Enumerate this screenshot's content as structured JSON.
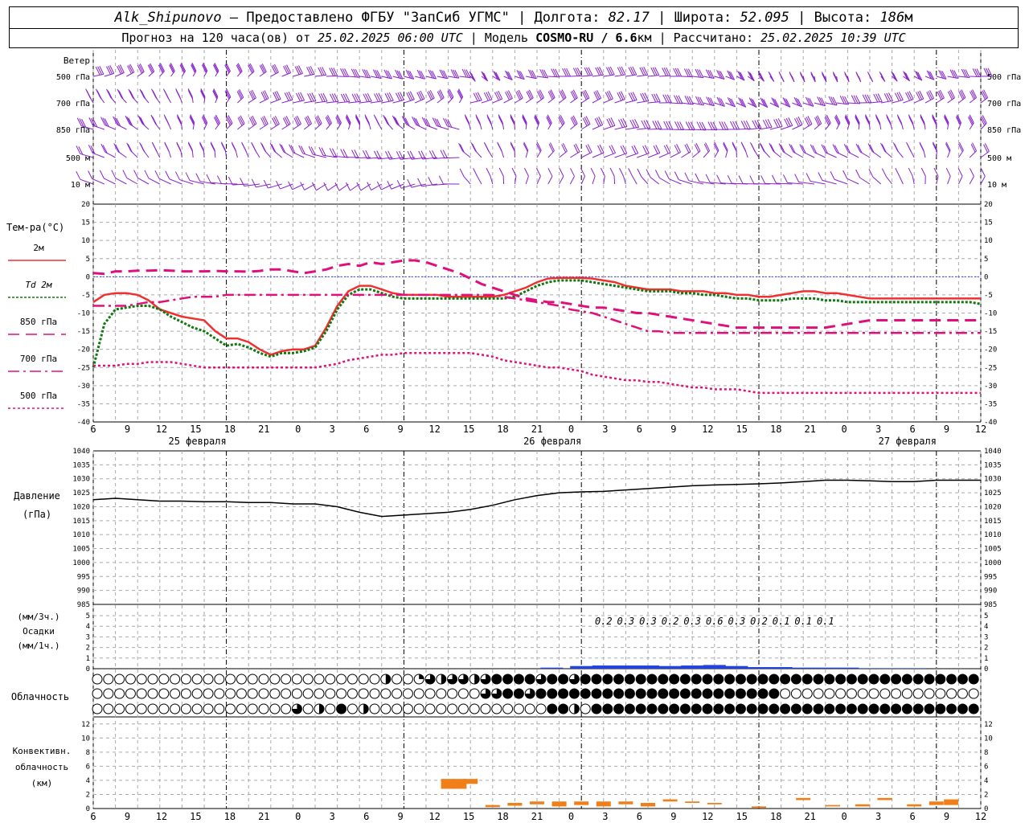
{
  "header": {
    "station": "Alk_Shipunovo",
    "provider": " – Предоставлено ФГБУ \"ЗапСиб УГМС\" | Долгота: ",
    "lon": "82.17",
    "lat_label": " | Широта: ",
    "lat": "52.095",
    "alt_label": " | Высота: ",
    "alt": "186",
    "alt_unit": "м",
    "forecast_label": "Прогноз на 120 часа(ов) от ",
    "start_time": "25.02.2025 06:00 UTC",
    "model_label": "  | Модель ",
    "model": "COSMO-RU / 6.6",
    "model_unit": "км",
    "calc_label": " | Рассчитано: ",
    "calc_time": "25.02.2025 10:39 UTC"
  },
  "colors": {
    "wind": "#8822cc",
    "t2m": "#f03030",
    "td2m": "#107810",
    "t850": "#e0107a",
    "t700": "#e0107a",
    "t500": "#e0107a",
    "zero_line": "#3344dd",
    "pressure": "#000000",
    "precip": "#2244dd",
    "conv": "#f07f1a",
    "grid": "#aaaaaa"
  },
  "time_axis": {
    "ticks": [
      "6",
      "9",
      "12",
      "15",
      "18",
      "21",
      "0",
      "3",
      "6",
      "9",
      "12",
      "15",
      "18",
      "21",
      "0",
      "3",
      "6",
      "9",
      "12",
      "15",
      "18",
      "21",
      "0",
      "3",
      "6",
      "9",
      "12"
    ],
    "dates": [
      "25 февраля",
      "26 февраля",
      "27 февраля"
    ]
  },
  "wind_panel": {
    "title": "Ветер",
    "levels": [
      "500 гПа",
      "700 гПа",
      "850 гПа",
      "500 м",
      "10  м"
    ]
  },
  "temp_panel": {
    "title": "Тем-ра(°C)",
    "legend": [
      {
        "label": "2м",
        "style": "solid"
      },
      {
        "label": "Td 2м",
        "style": "dotted-thick"
      },
      {
        "label": "850 гПа",
        "style": "dash"
      },
      {
        "label": "700 гПа",
        "style": "dashdot"
      },
      {
        "label": "500 гПа",
        "style": "dot"
      }
    ]
  },
  "pressure_panel": {
    "title_1": "Давление",
    "title_2": "(гПа)"
  },
  "precip_panel": {
    "title_1": "(мм/3ч.)",
    "title_2": "Осадки",
    "title_3": "(мм/1ч.)"
  },
  "cloud_panel": {
    "title": "Облачность"
  },
  "conv_panel": {
    "title_1": "Конвективн.",
    "title_2": "облачность",
    "title_3": "(км)"
  },
  "chart_data": [
    {
      "type": "line",
      "name": "temperature",
      "x_hours": [
        0,
        1.5,
        3,
        4.5,
        6,
        7.5,
        9,
        10.5,
        12,
        13.5,
        15,
        16.5,
        18,
        19.5,
        21,
        22.5,
        24,
        25.5,
        27,
        28.5,
        30,
        31.5,
        33,
        34.5,
        36,
        37.5,
        39,
        40.5,
        42,
        43.5,
        45,
        46.5,
        48,
        49.5,
        51,
        52.5,
        54,
        55.5,
        57,
        58.5,
        60,
        61.5,
        63,
        64.5,
        66,
        67.5,
        69,
        70.5,
        72,
        73.5,
        75,
        76.5,
        78,
        79.5,
        81,
        82.5,
        84,
        85.5,
        87,
        88.5,
        90,
        91.5,
        93,
        94.5,
        96,
        97.5,
        99,
        100.5,
        102,
        103.5,
        105,
        106.5,
        108,
        109.5,
        111,
        112.5,
        114,
        115.5,
        117,
        118.5,
        120
      ],
      "ylim": [
        -40,
        20
      ],
      "yticks": [
        -40,
        -35,
        -30,
        -25,
        -20,
        -15,
        -10,
        -5,
        0,
        5,
        10,
        15,
        20
      ],
      "series": [
        {
          "name": "2м",
          "values": [
            -7,
            -5,
            -4.5,
            -4.5,
            -5,
            -6.5,
            -9,
            -10,
            -11,
            -11.5,
            -12,
            -15,
            -17,
            -17,
            -18,
            -20,
            -21.5,
            -20.5,
            -20,
            -20,
            -19,
            -14,
            -8,
            -4,
            -2.5,
            -2.5,
            -3.5,
            -4.5,
            -5,
            -5,
            -5,
            -5,
            -5.5,
            -5.5,
            -5.5,
            -5.5,
            -5.5,
            -5,
            -4,
            -3,
            -1.5,
            -0.5,
            -0.3,
            -0.3,
            -0.3,
            -0.5,
            -1,
            -1.5,
            -2.5,
            -3,
            -3.5,
            -3.5,
            -3.5,
            -4,
            -4,
            -4,
            -4.5,
            -4.5,
            -5,
            -5,
            -5.5,
            -5.5,
            -5,
            -4.5,
            -4,
            -4,
            -4.5,
            -4.5,
            -5,
            -5.5,
            -6,
            -6,
            -6,
            -6,
            -6,
            -6,
            -6,
            -6,
            -6,
            -6,
            -6
          ]
        },
        {
          "name": "Td 2м",
          "values": [
            -25,
            -13,
            -9,
            -8.5,
            -8,
            -8,
            -9,
            -11,
            -12.5,
            -14,
            -15,
            -17,
            -19,
            -18.5,
            -19.5,
            -21,
            -22,
            -21,
            -21,
            -20.5,
            -19.5,
            -15,
            -9,
            -5,
            -3.5,
            -3.5,
            -4.5,
            -5.5,
            -6,
            -6,
            -6,
            -6,
            -6,
            -6,
            -6,
            -6,
            -6,
            -6,
            -5.5,
            -4,
            -2.5,
            -1.5,
            -1,
            -1,
            -1,
            -1.5,
            -2,
            -2.5,
            -3,
            -3.5,
            -4,
            -4,
            -4,
            -4.5,
            -4.5,
            -5,
            -5,
            -5.5,
            -6,
            -6,
            -6.5,
            -6.5,
            -6.5,
            -6,
            -6,
            -6,
            -6.5,
            -6.5,
            -7,
            -7,
            -7,
            -7,
            -7,
            -7,
            -7,
            -7,
            -7,
            -7,
            -7,
            -7,
            -7.5
          ]
        },
        {
          "name": "850 гПа",
          "values": [
            1,
            0.8,
            1.5,
            1.5,
            1.7,
            1.7,
            1.8,
            1.7,
            1.5,
            1.5,
            1.5,
            1.6,
            1.5,
            1.5,
            1.4,
            1.6,
            2,
            2,
            1.5,
            1,
            1.5,
            2,
            3,
            3.5,
            3,
            4,
            3.5,
            4,
            4.5,
            4.5,
            4,
            3,
            2,
            1,
            -0.5,
            -2,
            -3,
            -4,
            -5,
            -6,
            -6.5,
            -7,
            -7,
            -7.5,
            -8,
            -8.5,
            -8.5,
            -9,
            -9.5,
            -10,
            -10,
            -10.5,
            -11,
            -11.5,
            -12,
            -12.5,
            -13,
            -13.5,
            -14,
            -14,
            -14,
            -14,
            -14,
            -14,
            -14,
            -14,
            -14,
            -13.5,
            -13,
            -12.5,
            -12,
            -12,
            -12,
            -12,
            -12,
            -12,
            -12,
            -12,
            -12,
            -12,
            -12
          ]
        },
        {
          "name": "700 гПа",
          "values": [
            -8,
            -8,
            -8,
            -8,
            -7.5,
            -7,
            -7,
            -6.5,
            -6,
            -5.5,
            -5.5,
            -5.5,
            -5,
            -5,
            -5,
            -5,
            -5,
            -5,
            -5,
            -5,
            -5,
            -5,
            -5,
            -5,
            -5,
            -5,
            -5,
            -5,
            -5,
            -5,
            -5,
            -5,
            -5,
            -5,
            -5,
            -5,
            -5,
            -5.5,
            -6,
            -6.5,
            -7,
            -7.5,
            -8,
            -9,
            -9.5,
            -10,
            -11,
            -12,
            -13,
            -14,
            -15,
            -15,
            -15.5,
            -15.5,
            -15.5,
            -15.5,
            -15.5,
            -15.5,
            -15.5,
            -15.5,
            -15.5,
            -15.5,
            -15.5,
            -15.5,
            -15.5,
            -15.5,
            -15.5,
            -15.5,
            -15.5,
            -15.5,
            -15.5,
            -15.5,
            -15.5,
            -15.5,
            -15.5,
            -15.5,
            -15.5,
            -15.5,
            -15.5,
            -15.5,
            -15.5
          ]
        },
        {
          "name": "500 гПа",
          "values": [
            -24.5,
            -24.5,
            -24.5,
            -24,
            -24,
            -23.5,
            -23.5,
            -23.5,
            -24,
            -24.5,
            -25,
            -25,
            -25,
            -25,
            -25,
            -25,
            -25,
            -25,
            -25,
            -25,
            -25,
            -24.5,
            -24,
            -23,
            -22.5,
            -22,
            -21.5,
            -21.5,
            -21,
            -21,
            -21,
            -21,
            -21,
            -21,
            -21,
            -21.5,
            -22,
            -23,
            -23.5,
            -24,
            -24.5,
            -25,
            -25,
            -25.5,
            -26,
            -27,
            -27.5,
            -28,
            -28.5,
            -28.5,
            -29,
            -29,
            -29.5,
            -30,
            -30.5,
            -30.5,
            -31,
            -31,
            -31,
            -31.5,
            -32,
            -32,
            -32,
            -32,
            -32,
            -32,
            -32,
            -32,
            -32,
            -32,
            -32,
            -32,
            -32,
            -32,
            -32,
            -32,
            -32,
            -32,
            -32,
            -32,
            -32
          ]
        }
      ]
    },
    {
      "type": "line",
      "name": "pressure",
      "x_hours": [
        0,
        3,
        6,
        9,
        12,
        15,
        18,
        21,
        24,
        27,
        30,
        33,
        36,
        39,
        42,
        45,
        48,
        51,
        54,
        57,
        60,
        63,
        66,
        69,
        72,
        75,
        78,
        81,
        84,
        87,
        90,
        93,
        96,
        99,
        102,
        105,
        108,
        111,
        114,
        117,
        120
      ],
      "ylim": [
        985,
        1040
      ],
      "yticks": [
        985,
        990,
        995,
        1000,
        1005,
        1010,
        1015,
        1020,
        1025,
        1030,
        1035,
        1040
      ],
      "values": [
        1022.5,
        1023,
        1022.5,
        1022,
        1022,
        1021.8,
        1021.8,
        1021.5,
        1021.5,
        1021,
        1021,
        1020,
        1018,
        1016.5,
        1017,
        1017.5,
        1018,
        1019,
        1020.5,
        1022.5,
        1024,
        1025,
        1025.3,
        1025.5,
        1026,
        1026.5,
        1027,
        1027.5,
        1027.8,
        1028,
        1028.2,
        1028.5,
        1029,
        1029.5,
        1029.5,
        1029.3,
        1029,
        1029,
        1029.5,
        1029.5,
        1029.5
      ]
    },
    {
      "type": "bar",
      "name": "precipitation",
      "ylim": [
        0,
        5
      ],
      "yticks": [
        0,
        1,
        2,
        3,
        4,
        5
      ],
      "labels_x_hours": [
        69,
        72,
        75,
        78,
        81,
        84,
        87,
        90,
        93,
        96,
        99
      ],
      "labels": [
        "0.2",
        "0.3",
        "0.3",
        "0.2",
        "0.3",
        "0.6",
        "0.3",
        "0.2",
        "0.1",
        "0.1",
        "0.1"
      ],
      "hourly_x": [
        62,
        66,
        69,
        72,
        75,
        78,
        81,
        84,
        87,
        90,
        93,
        96,
        99,
        102,
        105,
        108,
        111
      ],
      "hourly_values": [
        0.1,
        0.25,
        0.3,
        0.3,
        0.3,
        0.25,
        0.3,
        0.35,
        0.25,
        0.15,
        0.15,
        0.1,
        0.1,
        0.1,
        0.05,
        0.05,
        0.05
      ]
    },
    {
      "type": "table",
      "name": "cloudiness",
      "note": "three rows of cloud cover symbols, 81 per row (1.5h step); value = tenths of octants filled 0..4",
      "rows": [
        [
          0,
          0,
          0,
          0,
          0,
          0,
          0,
          0,
          0,
          0,
          0,
          0,
          0,
          0,
          0,
          0,
          0,
          0,
          0,
          0,
          0,
          0,
          0,
          0,
          0,
          0,
          2,
          0,
          0,
          1,
          3,
          2,
          3,
          3,
          2,
          3,
          4,
          4,
          4,
          4,
          3,
          4,
          4,
          3,
          4,
          4,
          4,
          4,
          4,
          4,
          4,
          4,
          4,
          4,
          4,
          4,
          4,
          4,
          4,
          4,
          4,
          4,
          4,
          4,
          4,
          4,
          4,
          4,
          4,
          4,
          4,
          4,
          4,
          4,
          4,
          4,
          4,
          4,
          4,
          4,
          4
        ],
        [
          0,
          0,
          0,
          0,
          0,
          0,
          0,
          0,
          0,
          0,
          0,
          0,
          0,
          0,
          0,
          0,
          0,
          0,
          0,
          0,
          0,
          0,
          0,
          0,
          0,
          0,
          0,
          0,
          0,
          0,
          0,
          0,
          0,
          0,
          0,
          3,
          3,
          4,
          4,
          3,
          4,
          4,
          4,
          4,
          4,
          4,
          4,
          4,
          4,
          4,
          4,
          4,
          4,
          4,
          4,
          4,
          4,
          4,
          4,
          4,
          4,
          4,
          0,
          0,
          0,
          0,
          0,
          0,
          0,
          0,
          0,
          0,
          0,
          0,
          0,
          0,
          0,
          0,
          0,
          0,
          0
        ],
        [
          0,
          0,
          0,
          0,
          0,
          0,
          0,
          0,
          0,
          0,
          0,
          0,
          0,
          0,
          0,
          0,
          0,
          0,
          3,
          0,
          2,
          0,
          4,
          0,
          2,
          0,
          0,
          0,
          0,
          0,
          0,
          0,
          0,
          0,
          0,
          0,
          0,
          0,
          0,
          0,
          0,
          4,
          4,
          2,
          0,
          4,
          4,
          4,
          4,
          4,
          4,
          4,
          4,
          4,
          4,
          4,
          4,
          4,
          4,
          4,
          4,
          4,
          4,
          4,
          4,
          4,
          4,
          4,
          4,
          4,
          4,
          4,
          4,
          4,
          4,
          4,
          4,
          4,
          4,
          4,
          4
        ]
      ]
    },
    {
      "type": "bar",
      "name": "convective_cloud",
      "ylim": [
        0,
        13
      ],
      "yticks": [
        0,
        2,
        4,
        6,
        8,
        10,
        12
      ],
      "bars": [
        {
          "x": 48,
          "bottom": 2.8,
          "top": 4.2
        },
        {
          "x": 49.5,
          "bottom": 2.8,
          "top": 4.2
        },
        {
          "x": 51,
          "bottom": 3.5,
          "top": 4.2
        },
        {
          "x": 54,
          "bottom": 0.2,
          "top": 0.5
        },
        {
          "x": 57,
          "bottom": 0.4,
          "top": 0.8
        },
        {
          "x": 60,
          "bottom": 0.6,
          "top": 1.0
        },
        {
          "x": 63,
          "bottom": 0.3,
          "top": 1.0
        },
        {
          "x": 66,
          "bottom": 0.5,
          "top": 1.0
        },
        {
          "x": 69,
          "bottom": 0.3,
          "top": 1.0
        },
        {
          "x": 72,
          "bottom": 0.6,
          "top": 1.0
        },
        {
          "x": 75,
          "bottom": 0.3,
          "top": 0.8
        },
        {
          "x": 78,
          "bottom": 1.0,
          "top": 1.3
        },
        {
          "x": 81,
          "bottom": 0.8,
          "top": 1.0
        },
        {
          "x": 84,
          "bottom": 0.6,
          "top": 0.8
        },
        {
          "x": 90,
          "bottom": 0.1,
          "top": 0.3
        },
        {
          "x": 96,
          "bottom": 1.2,
          "top": 1.5
        },
        {
          "x": 100,
          "bottom": 0.3,
          "top": 0.5
        },
        {
          "x": 104,
          "bottom": 0.3,
          "top": 0.6
        },
        {
          "x": 107,
          "bottom": 1.2,
          "top": 1.5
        },
        {
          "x": 111,
          "bottom": 0.3,
          "top": 0.6
        },
        {
          "x": 114,
          "bottom": 0.5,
          "top": 1.0
        },
        {
          "x": 116,
          "bottom": 0.5,
          "top": 1.3
        }
      ]
    }
  ]
}
